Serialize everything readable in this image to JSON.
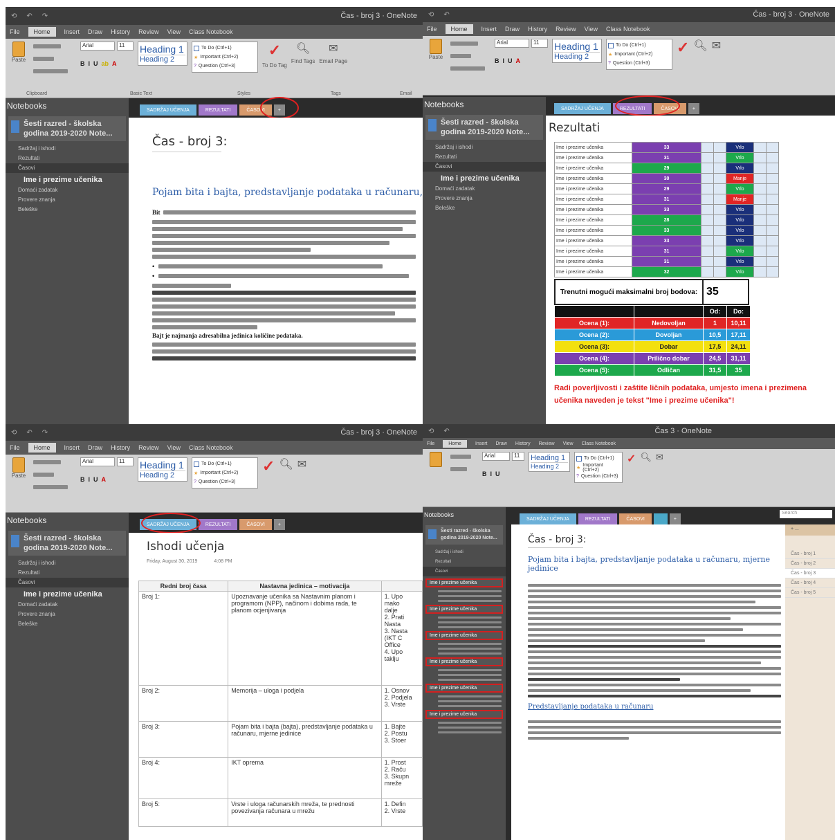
{
  "q1": {
    "title": "Čas - broj 3 · OneNote",
    "menu": [
      "File",
      "Home",
      "Insert",
      "Draw",
      "History",
      "Review",
      "View",
      "Class Notebook"
    ],
    "ribbon": {
      "paste": "Paste",
      "font": "Arial",
      "size": "11",
      "h1": "Heading 1",
      "h2": "Heading 2",
      "tags": [
        "To Do (Ctrl+1)",
        "Important (Ctrl+2)",
        "Question (Ctrl+3)"
      ],
      "todo": "To Do Tag",
      "find": "Find Tags",
      "email": "Email Page",
      "groups": [
        "Clipboard",
        "Basic Text",
        "Styles",
        "Tags",
        "Email"
      ]
    },
    "notebooks": {
      "label": "Notebooks",
      "name": "Šesti razred - školska godina 2019-2020 Note...",
      "sections": [
        "Sadržaj i ishodi",
        "Rezultati",
        "Časovi"
      ],
      "group": "Ime i prezime učenika",
      "group_items": [
        "Domaći zadatak",
        "Provere znanja",
        "Beleške"
      ]
    },
    "tabs": [
      "SADRŽAJ UČENJA",
      "REZULTATI",
      "ČASOVI",
      "+"
    ],
    "page_title": "Čas - broj 3:",
    "heading": "Pojam bita i bajta, predstavljanje podataka u računaru, m",
    "bit_lead": "Bit",
    "bits_line": "Bajt je najmanja adresabilna jedinica količine podataka."
  },
  "q2": {
    "title": "Čas - broj 3 · OneNote",
    "notebooks": {
      "label": "Notebooks",
      "name": "Šesti razred - školska godina 2019-2020 Note...",
      "group": "Ime i prezime učenika"
    },
    "tabs": [
      "SADRŽAJ UČENJA",
      "REZULTATI",
      "ČASOVI",
      "+"
    ],
    "page_title": "Rezultati",
    "rows": [
      {
        "name": "Ime i prezime učenika",
        "pts": "33",
        "c": "#7b3fb0",
        "st": "Vrlo",
        "sc": "#1a2f7a"
      },
      {
        "name": "Ime i prezime učenika",
        "pts": "31",
        "c": "#7b3fb0",
        "st": "Vrlo",
        "sc": "#1da84c"
      },
      {
        "name": "Ime i prezime učenika",
        "pts": "29",
        "c": "#1da84c",
        "st": "Vrlo",
        "sc": "#1a2f7a"
      },
      {
        "name": "Ime i prezime učenika",
        "pts": "30",
        "c": "#7b3fb0",
        "st": "Manje",
        "sc": "#e02525"
      },
      {
        "name": "Ime i prezime učenika",
        "pts": "29",
        "c": "#7b3fb0",
        "st": "Vrlo",
        "sc": "#1da84c"
      },
      {
        "name": "Ime i prezime učenika",
        "pts": "31",
        "c": "#7b3fb0",
        "st": "Manje",
        "sc": "#e02525"
      },
      {
        "name": "Ime i prezime učenika",
        "pts": "33",
        "c": "#7b3fb0",
        "st": "Vrlo",
        "sc": "#1a2f7a"
      },
      {
        "name": "Ime i prezime učenika",
        "pts": "28",
        "c": "#1da84c",
        "st": "Vrlo",
        "sc": "#1a2f7a"
      },
      {
        "name": "Ime i prezime učenika",
        "pts": "33",
        "c": "#1da84c",
        "st": "Vrlo",
        "sc": "#1a2f7a"
      },
      {
        "name": "Ime i prezime učenika",
        "pts": "33",
        "c": "#7b3fb0",
        "st": "Vrlo",
        "sc": "#1a2f7a"
      },
      {
        "name": "Ime i prezime učenika",
        "pts": "31",
        "c": "#7b3fb0",
        "st": "Vrlo",
        "sc": "#1da84c"
      },
      {
        "name": "Ime i prezime učenika",
        "pts": "31",
        "c": "#7b3fb0",
        "st": "Vrlo",
        "sc": "#1a2f7a"
      },
      {
        "name": "Ime i prezime učenika",
        "pts": "32",
        "c": "#1da84c",
        "st": "Vrlo",
        "sc": "#1da84c"
      }
    ],
    "max_label": "Trenutni mogući maksimalni broj bodova:",
    "max_value": "35",
    "od": "Od:",
    "do": "Do:",
    "grades": [
      {
        "o": "Ocena (1):",
        "w": "Nedovoljan",
        "f": "1",
        "t": "10,11",
        "c": "#e02525"
      },
      {
        "o": "Ocena (2):",
        "w": "Dovoljan",
        "f": "10,5",
        "t": "17,11",
        "c": "#2a9ad8"
      },
      {
        "o": "Ocena (3):",
        "w": "Dobar",
        "f": "17,5",
        "t": "24,11",
        "c": "#f3e00e"
      },
      {
        "o": "Ocena (4):",
        "w": "Prilično dobar",
        "f": "24,5",
        "t": "31,11",
        "c": "#7b3fb0"
      },
      {
        "o": "Ocena (5):",
        "w": "Odličan",
        "f": "31,5",
        "t": "35",
        "c": "#1da84c"
      }
    ],
    "note": "Radi poverljivosti i zaštite ličnih podataka, umjesto imena i prezimena učenika naveden je tekst \"Ime i prezime učenika\"!"
  },
  "q3": {
    "title": "Čas - broj 3 · OneNote",
    "page_title": "Ishodi učenja",
    "date": "Friday, August 30, 2019",
    "time": "4:08 PM",
    "th": [
      "Redni broj časa",
      "Nastavna jedinica – motivacija",
      ""
    ],
    "rows": [
      {
        "n": "Broj 1:",
        "t": "Upoznavanje učenika sa Nastavnim planom i programom (NPP), načinom i dobima rada, te planom ocjenjivanja",
        "o": [
          "1. Upo",
          "mako",
          "dalje",
          "2. Prati",
          "Nasta",
          "3. Nasta",
          "(IKT C",
          "Office",
          "4. Upo",
          "taklju"
        ]
      },
      {
        "n": "Broj 2:",
        "t": "Memorija – uloga i podjela",
        "o": [
          "1. Osnov",
          "2. Podjela",
          "3. Vrste"
        ]
      },
      {
        "n": "Broj 3:",
        "t": "Pojam bita i bajta (bajta), predstavljanje podataka u računaru, mjerne jedinice",
        "o": [
          "1. Bajte",
          "2. Postu",
          "3. Stoer"
        ]
      },
      {
        "n": "Broj 4:",
        "t": "IKT oprema",
        "o": [
          "1. Prost",
          "2. Raču",
          "3. Skupn",
          "mreže"
        ]
      },
      {
        "n": "Broj 5:",
        "t": "Vrste i uloga računarskih mreža, te prednosti povezivanja računara u mrežu",
        "o": [
          "1. Defin",
          "2. Vrste"
        ]
      }
    ]
  },
  "q4": {
    "title": "Čas 3 · OneNote",
    "page_title": "Čas - broj 3:",
    "heading": "Pojam bita i bajta, predstavljanje podataka u računaru, mjerne jedinice",
    "link": "Predstavljanje podataka u računaru",
    "pages": [
      "Čas - broj 1",
      "Čas - broj 2",
      "Čas - broj 3",
      "Čas - broj 4",
      "Čas - broj 5"
    ],
    "search": "Search",
    "red": [
      "Ime i prezime učenika",
      "Ime i prezime učenika",
      "Ime i prezime učenika",
      "Ime i prezime učenika",
      "Ime i prezime učenika",
      "Ime i prezime učenika"
    ]
  }
}
